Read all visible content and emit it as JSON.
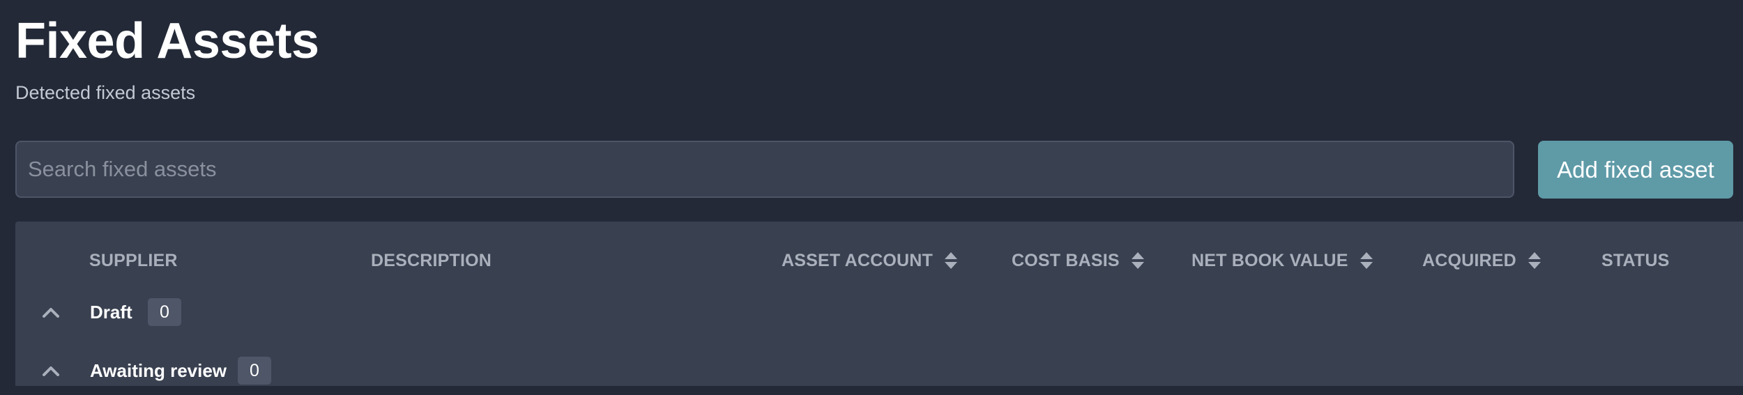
{
  "header": {
    "title": "Fixed Assets",
    "subtitle": "Detected fixed assets"
  },
  "search": {
    "placeholder": "Search fixed assets",
    "value": ""
  },
  "actions": {
    "add_label": "Add fixed asset"
  },
  "table": {
    "columns": [
      {
        "label": "SUPPLIER",
        "sortable": false
      },
      {
        "label": "DESCRIPTION",
        "sortable": false
      },
      {
        "label": "ASSET ACCOUNT",
        "sortable": true,
        "icon": "sort-icon"
      },
      {
        "label": "COST BASIS",
        "sortable": true,
        "icon": "sort-icon"
      },
      {
        "label": "NET BOOK VALUE",
        "sortable": true,
        "icon": "sort-icon"
      },
      {
        "label": "ACQUIRED",
        "sortable": true,
        "icon": "sort-icon"
      },
      {
        "label": "STATUS",
        "sortable": false
      }
    ],
    "groups": [
      {
        "label": "Draft",
        "count": "0",
        "icon": "chevron-up-icon",
        "expanded": true
      },
      {
        "label": "Awaiting review",
        "count": "0",
        "icon": "chevron-up-icon",
        "expanded": true
      }
    ]
  },
  "colors": {
    "background": "#232937",
    "panel": "#394050",
    "accent_button": "#5f9aa7",
    "header_text": "#aab0bc",
    "badge": "#4f5668"
  }
}
